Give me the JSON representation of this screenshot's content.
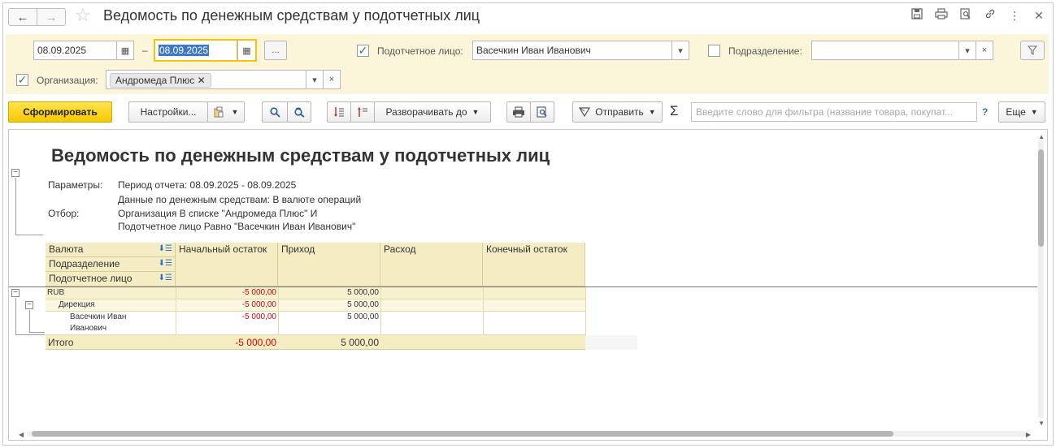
{
  "window": {
    "title": "Ведомость по денежным средствам у подотчетных лиц",
    "nav_back": "←",
    "nav_forward": "→"
  },
  "filters": {
    "date_from": "08.09.2025",
    "date_sep": "–",
    "date_to": "08.09.2025",
    "period_btn": "...",
    "person_label": "Подотчетное лицо:",
    "person_value": "Васечкин Иван Иванович",
    "dept_label": "Подразделение:",
    "dept_value": "",
    "org_label": "Организация:",
    "org_tag": "Андромеда Плюс",
    "clear": "×"
  },
  "toolbar": {
    "generate": "Сформировать",
    "settings": "Настройки...",
    "expand_to": "Разворачивать до",
    "send": "Отправить",
    "search_placeholder": "Введите слово для фильтра (название товара, покупат...",
    "help": "?",
    "more": "Еще",
    "sigma": "Σ"
  },
  "report": {
    "title": "Ведомость по денежным средствам у подотчетных лиц",
    "params_label": "Параметры:",
    "period": "Период отчета: 08.09.2025 - 08.09.2025",
    "currency_mode": "Данные по денежным средствам: В валюте операций",
    "filter_label": "Отбор:",
    "filter_line1": "Организация В списке \"Андромеда Плюс\" И",
    "filter_line2": "Подотчетное лицо Равно \"Васечкин Иван Иванович\"",
    "headers": {
      "group1": "Валюта",
      "group2": "Подразделение",
      "group3": "Подотчетное лицо",
      "opening": "Начальный остаток",
      "income": "Приход",
      "expense": "Расход",
      "closing": "Конечный остаток"
    },
    "rows": [
      {
        "label": "RUB",
        "opening": "-5 000,00",
        "income": "5 000,00",
        "expense": "",
        "closing": ""
      },
      {
        "label": "Дирекция",
        "opening": "-5 000,00",
        "income": "5 000,00",
        "expense": "",
        "closing": ""
      },
      {
        "label1": "Васечкин Иван",
        "label2": "Иванович",
        "opening": "-5 000,00",
        "income": "5 000,00",
        "expense": "",
        "closing": ""
      }
    ],
    "total": {
      "label": "Итого",
      "opening": "-5 000,00",
      "income": "5 000,00",
      "expense": "",
      "closing": ""
    }
  }
}
